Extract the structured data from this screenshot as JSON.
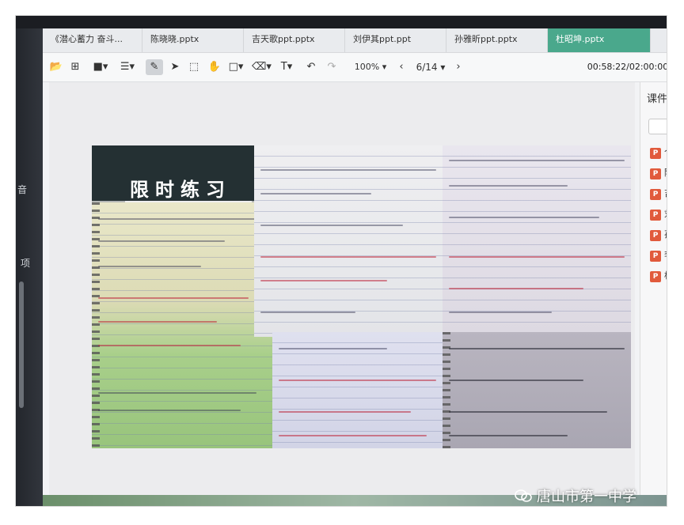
{
  "tabs": [
    {
      "label": "《潜心蓄力  奋斗...",
      "active": false
    },
    {
      "label": "陈晓晓.pptx",
      "active": false
    },
    {
      "label": "吉天歌ppt.pptx",
      "active": false
    },
    {
      "label": "刘伊其ppt.ppt",
      "active": false
    },
    {
      "label": "孙雅昕ppt.pptx",
      "active": false
    },
    {
      "label": "杜昭坤.pptx",
      "active": true
    }
  ],
  "toolbar": {
    "zoom": "100%",
    "page": "6/14",
    "timer": "00:58:22/02:00:00",
    "text_tool": "T"
  },
  "slide": {
    "title": "限时练习"
  },
  "left_strip": {
    "label1": "音",
    "label2": "项"
  },
  "right_panel": {
    "title": "课件",
    "items": [
      "个",
      "陈",
      "吉",
      "刘",
      "孙",
      "李",
      "杜"
    ],
    "ppt_badge": "P"
  },
  "watermark": "唐山市第一中学",
  "colors": {
    "active_tab": "#4aa88c",
    "ppt_icon": "#e15a3c",
    "title_panel": "#243033"
  }
}
